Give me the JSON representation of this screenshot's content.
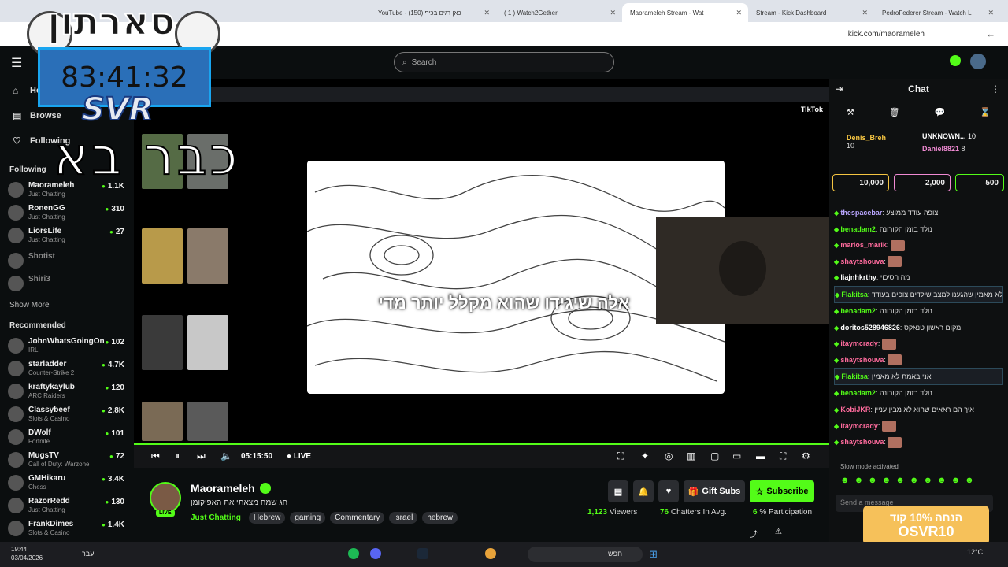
{
  "browser": {
    "tabs": [
      {
        "title": "YouTube - כאן רגים בכיף (150)",
        "active": false
      },
      {
        "title": "( 1 ) Watch2Gether",
        "active": false
      },
      {
        "title": "Maorameleh Stream - Wat",
        "active": true
      },
      {
        "title": "Stream - Kick Dashboard",
        "active": false
      },
      {
        "title": "PedroFederer Stream - Watch L",
        "active": false
      }
    ],
    "url": "kick.com/maorameleh"
  },
  "header": {
    "search_placeholder": "Search"
  },
  "sidebar": {
    "nav": [
      {
        "label": "Home",
        "icon": "home-icon"
      },
      {
        "label": "Browse",
        "icon": "browse-icon"
      },
      {
        "label": "Following",
        "icon": "heart-icon"
      }
    ],
    "following_title": "Following",
    "following": [
      {
        "name": "Maorameleh",
        "category": "Just Chatting",
        "viewers": "1.1K"
      },
      {
        "name": "RonenGG",
        "category": "Just Chatting",
        "viewers": "310"
      },
      {
        "name": "LiorsLife",
        "category": "Just Chatting",
        "viewers": "27"
      },
      {
        "name": "Shotist",
        "category": "",
        "viewers": ""
      },
      {
        "name": "Shiri3",
        "category": "",
        "viewers": ""
      }
    ],
    "show_more": "Show More",
    "recommended_title": "Recommended",
    "recommended": [
      {
        "name": "JohnWhatsGoingOn",
        "category": "IRL",
        "viewers": "102"
      },
      {
        "name": "starladder",
        "category": "Counter-Strike 2",
        "viewers": "4.7K"
      },
      {
        "name": "kraftykaylub",
        "category": "ARC Raiders",
        "viewers": "120"
      },
      {
        "name": "Classybeef",
        "category": "Slots & Casino",
        "viewers": "2.8K"
      },
      {
        "name": "DWolf",
        "category": "Fortnite",
        "viewers": "101"
      },
      {
        "name": "MugsTV",
        "category": "Call of Duty: Warzone",
        "viewers": "72"
      },
      {
        "name": "GMHikaru",
        "category": "Chess",
        "viewers": "3.4K"
      },
      {
        "name": "RazorRedd",
        "category": "Just Chatting",
        "viewers": "130"
      },
      {
        "name": "FrankDimes",
        "category": "Slots & Casino",
        "viewers": "1.4K"
      }
    ]
  },
  "overlay": {
    "top_text": "סארתון",
    "timer": "83:41:32",
    "svr": "SVR",
    "hebrew_big": "כבר בא"
  },
  "player": {
    "subtitle": "אלה שיגידו שהוא מקלל יותר מדי",
    "tiktok_label": "TikTok",
    "time": "05:15:50",
    "live_label": "LIVE"
  },
  "stream": {
    "name": "Maorameleh",
    "title": "חג שמח מצאתי את האפיקומן",
    "category": "Just Chatting",
    "tags": [
      "Hebrew",
      "gaming",
      "Commentary",
      "israel",
      "hebrew"
    ],
    "live_badge": "LIVE",
    "gift_subs": "Gift Subs",
    "subscribe": "Subscribe",
    "viewers": "1,123",
    "viewers_label": "Viewers",
    "chatters": "76",
    "chatters_label": "Chatters In Avg.",
    "participation": "6",
    "participation_label": "% Participation"
  },
  "chat": {
    "title": "Chat",
    "top_gifters": [
      {
        "name": "Denis_Breh",
        "count": "10"
      },
      {
        "name": "UNKNOWN...",
        "count": "10"
      },
      {
        "name": "Daniel8821",
        "count": "8"
      }
    ],
    "predictions": [
      "10,000",
      "2,000",
      "500"
    ],
    "messages": [
      {
        "user": "thespacebar",
        "color": "#b9a6ff",
        "text": "צופה עודד ממוצע"
      },
      {
        "user": "benadam2",
        "color": "#53fc18",
        "text": "נולד בזמן הקורונה"
      },
      {
        "user": "marios_marik",
        "color": "#ff6b9d",
        "text": "",
        "emote": true
      },
      {
        "user": "shaytshouva",
        "color": "#ff6b9d",
        "text": "",
        "emote": true
      },
      {
        "user": "liajnhkrthy",
        "color": "#ffffff",
        "text": "מה הסיכוי",
        "plain": true
      },
      {
        "user": "Flakitsa",
        "color": "#53fc18",
        "text": "אני לא מאמין שהגענו למצב שילדים צופים בעודד",
        "hl": true
      },
      {
        "user": "benadam2",
        "color": "#53fc18",
        "text": "נולד בזמן הקורונה"
      },
      {
        "user": "doritos528946826",
        "color": "#ffffff",
        "text": "מקום ראשון טנאקס",
        "plain": true
      },
      {
        "user": "itaymcrady",
        "color": "#ff6b9d",
        "text": "",
        "emote": true
      },
      {
        "user": "shaytshouva",
        "color": "#ff6b9d",
        "text": "",
        "emote": true
      },
      {
        "user": "Flakitsa",
        "color": "#53fc18",
        "text": "אני באמת לא מאמין",
        "hl": true
      },
      {
        "user": "benadam2",
        "color": "#53fc18",
        "text": "נולד בזמן הקורונה"
      },
      {
        "user": "KobiJKR",
        "color": "#ff6b9d",
        "text": "איך הם ראאים שהוא לא מבין עניין",
        "plain": true
      },
      {
        "user": "itaymcrady",
        "color": "#ff6b9d",
        "text": "",
        "emote": true
      },
      {
        "user": "shaytshouva",
        "color": "#ff6b9d",
        "text": "",
        "emote": true
      }
    ],
    "slow_mode": "Slow mode activated",
    "send_placeholder": "Send a message"
  },
  "promo": {
    "line1": "הנחה 10% קוד",
    "line2": "OSVR10"
  },
  "taskbar": {
    "time": "19:44",
    "date": "03/04/2026",
    "lang": "עבר",
    "search": "חפש",
    "temp": "12°C"
  }
}
